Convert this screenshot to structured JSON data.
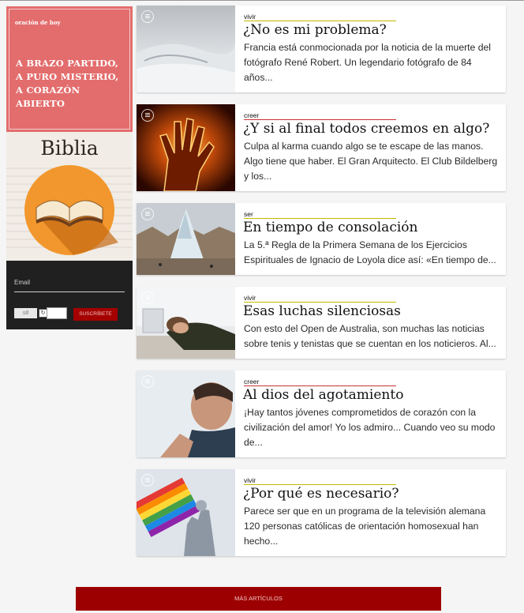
{
  "sidebar": {
    "promo": {
      "kicker": "oración de hoy",
      "title": "A BRAZO PARTIDO, A PURO MISTERIO, A CORAZÓN ABIERTO"
    },
    "bible": {
      "title": "Biblia"
    },
    "newsletter": {
      "email_label": "Email",
      "captcha_text": "s8",
      "subscribe_label": "SUSCRÍBETE"
    }
  },
  "articles": [
    {
      "category": "vivir",
      "title": "¿No es mi problema?",
      "excerpt": "Francia está conmocionada por la noticia de la muerte del fotógrafo René Robert. Un legendario fotógrafo de 84 años..."
    },
    {
      "category": "creer",
      "title": "¿Y si al final todos creemos en algo?",
      "excerpt": "Culpa al karma cuando algo se te escape de las manos. Algo tiene que haber. El Gran Arquitecto. El Club Bildelberg y los..."
    },
    {
      "category": "ser",
      "title": "En tiempo de consolación",
      "excerpt": "La 5.ª Regla de la Primera Semana de los Ejercicios Espirituales de Ignacio de Loyola dice así: «En tiempo de..."
    },
    {
      "category": "vivir",
      "title": "Esas luchas silenciosas",
      "excerpt": "Con esto del Open de Australia, son muchas las noticias sobre tenis y tenistas que se cuentan en los noticieros. Al..."
    },
    {
      "category": "creer",
      "title": "Al dios del agotamiento",
      "excerpt": "¡Hay tantos jóvenes comprometidos de corazón con la civilización del amor! Yo los admiro... Cuando veo su modo de..."
    },
    {
      "category": "vivir",
      "title": "¿Por qué es necesario?",
      "excerpt": "Parece ser que en un programa de la televisión alemana 120 personas católicas de orientación homosexual han hecho..."
    }
  ],
  "more_button": "MÁS ARTÍCULOS",
  "colors": {
    "promo_bg": "#e36d6d",
    "accent_red": "#9d0000",
    "category_rule_olive": "#c5b800",
    "category_rule_red": "#c83232"
  },
  "icons": [
    "document-icon",
    "refresh-icon"
  ]
}
